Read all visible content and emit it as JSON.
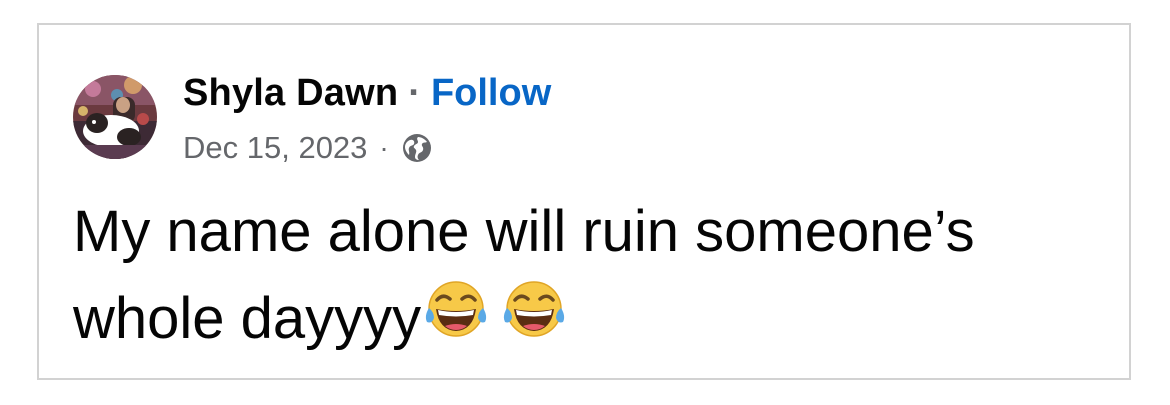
{
  "post": {
    "author": "Shyla Dawn",
    "separator": "·",
    "follow_label": "Follow",
    "date": "Dec 15, 2023",
    "meta_separator": "·",
    "audience_icon": "globe-icon",
    "text": "My name alone will ruin someone’s whole dayyyy",
    "emojis": [
      "face-with-tears-of-joy-icon",
      "face-with-tears-of-joy-icon"
    ]
  },
  "colors": {
    "follow": "#0866c6",
    "meta": "#65676b",
    "text": "#050505",
    "border": "#d2d2d2"
  }
}
